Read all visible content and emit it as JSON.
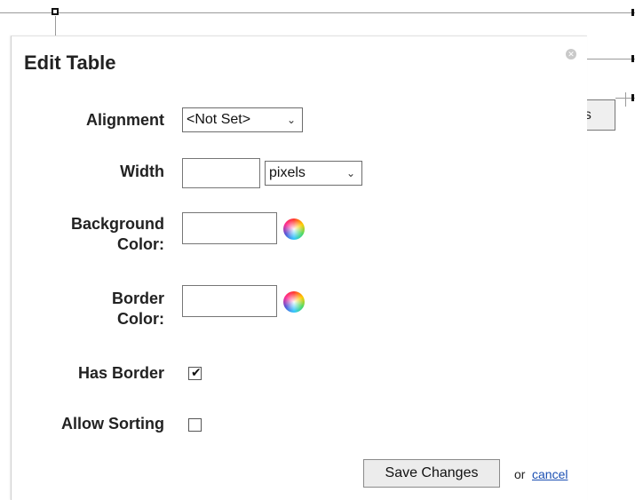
{
  "background": {
    "partial_button_label": "es"
  },
  "dialog": {
    "title": "Edit Table",
    "fields": {
      "alignment": {
        "label": "Alignment",
        "value": "<Not Set>"
      },
      "width": {
        "label": "Width",
        "value": "",
        "unit": "pixels"
      },
      "background_color": {
        "label_line1": "Background",
        "label_line2": "Color:",
        "value": ""
      },
      "border_color": {
        "label_line1": "Border",
        "label_line2": "Color:",
        "value": ""
      },
      "has_border": {
        "label": "Has Border",
        "checked": true
      },
      "allow_sorting": {
        "label": "Allow Sorting",
        "checked": false
      }
    },
    "actions": {
      "save_label": "Save Changes",
      "or_text": "or",
      "cancel_label": "cancel"
    }
  }
}
